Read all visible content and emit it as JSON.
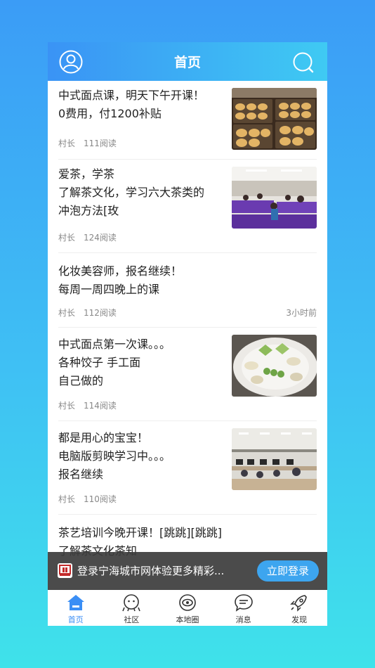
{
  "header": {
    "title": "首页",
    "profile_icon": "user-icon",
    "search_icon": "search-icon"
  },
  "feed": [
    {
      "title": "中式面点课，明天下午开课！\n0费用，付1200补贴",
      "author": "村长",
      "reads": "111阅读",
      "has_image": true,
      "image": "tray of baked pastries"
    },
    {
      "title": "爱茶，学茶\n了解茶文化，学习六大茶类的\n冲泡方法[玫",
      "author": "村长",
      "reads": "124阅读",
      "has_image": true,
      "image": "tea class room with purple tables"
    },
    {
      "title": "化妆美容师，报名继续！\n每周一周四晚上的课",
      "author": "村长",
      "reads": "112阅读",
      "time": "3小时前",
      "has_image": false
    },
    {
      "title": "中式面点第一次课。。。\n各种饺子 手工面\n自己做的",
      "author": "村长",
      "reads": "114阅读",
      "has_image": true,
      "image": "plate of handmade dumplings"
    },
    {
      "title": "都是用心的宝宝！\n电脑版剪映学习中。。。\n报名继续",
      "author": "村长",
      "reads": "110阅读",
      "has_image": true,
      "image": "computer classroom"
    },
    {
      "title": "茶艺培训今晚开课！[跳跳][跳跳]\n了解茶文化茶知",
      "author": "",
      "reads": "",
      "has_image": false
    }
  ],
  "login_banner": {
    "message": "登录宁海城市网体验更多精彩...",
    "button": "立即登录"
  },
  "tabbar": [
    {
      "label": "首页",
      "icon": "home-icon",
      "active": true
    },
    {
      "label": "社区",
      "icon": "community-icon",
      "active": false
    },
    {
      "label": "本地圈",
      "icon": "local-circle-icon",
      "active": false
    },
    {
      "label": "消息",
      "icon": "message-icon",
      "active": false
    },
    {
      "label": "发现",
      "icon": "rocket-icon",
      "active": false
    }
  ],
  "colors": {
    "accent": "#3a8ef5",
    "header_start": "#3a93f5",
    "header_end": "#3fcaf3",
    "banner_bg": "#3c3c3c"
  }
}
